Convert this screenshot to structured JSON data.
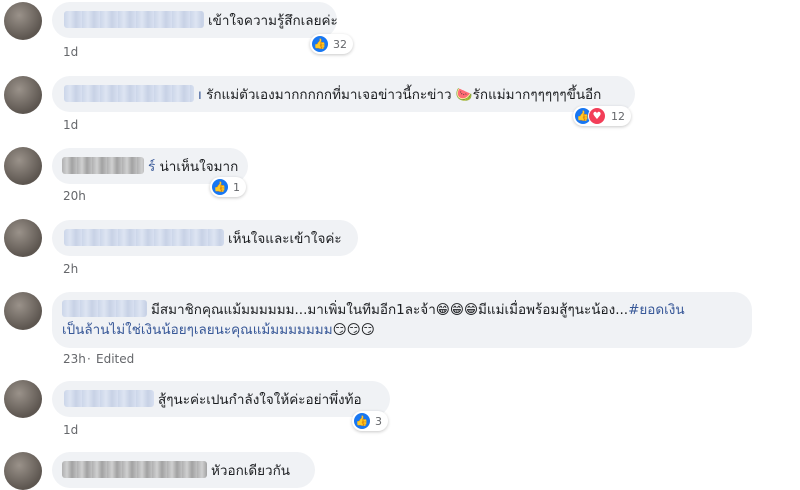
{
  "comments": [
    {
      "text": "เข้าใจความรู้สึกเลยค่ะ",
      "time": "1d",
      "count": "32"
    },
    {
      "name_fragment": "ı",
      "text": "รักแม่ตัวเองมากกกกกที่มาเจอข่าวนี้กะข่าว",
      "emoji1": "🍉",
      "text2": "รักแม่มากๆๆๆๆๆขึ้นอีก",
      "time": "1d",
      "count": "12"
    },
    {
      "name_fragment": "ร์",
      "text": "น่าเห็นใจมาก",
      "time": "20h",
      "count": "1"
    },
    {
      "text": "เห็นใจและเข้าใจค่ะ",
      "time": "2h"
    },
    {
      "line1": "มีสมาชิกคุณแม้มมมมมม...มาเพิ่มในทีมอีก1ละจ้า",
      "emoji_grin": "😁",
      "line1b": "มีแม่เมื่อพร้อมสู้ๆนะน้อง...",
      "hashtag": "#ยอดเงิน",
      "line2": "เป็นล้านไม่ใช่เงินน้อยๆเลยนะคุณแม้มมมมมมม",
      "emoji_smirk": "😏",
      "time": "23h",
      "edited": "Edited"
    },
    {
      "text": "สู้ๆนะค่ะเปนกำลังใจให้ค่ะอย่าพึ่งท้อ",
      "time": "1d",
      "count": "3"
    },
    {
      "text": "หัวอกเดียวกัน"
    }
  ],
  "icons": {
    "like": "like-icon",
    "heart": "love-icon"
  },
  "colors": {
    "bubble": "#f0f2f5",
    "like": "#1877f2",
    "love": "#f33e58",
    "link": "#385898"
  }
}
